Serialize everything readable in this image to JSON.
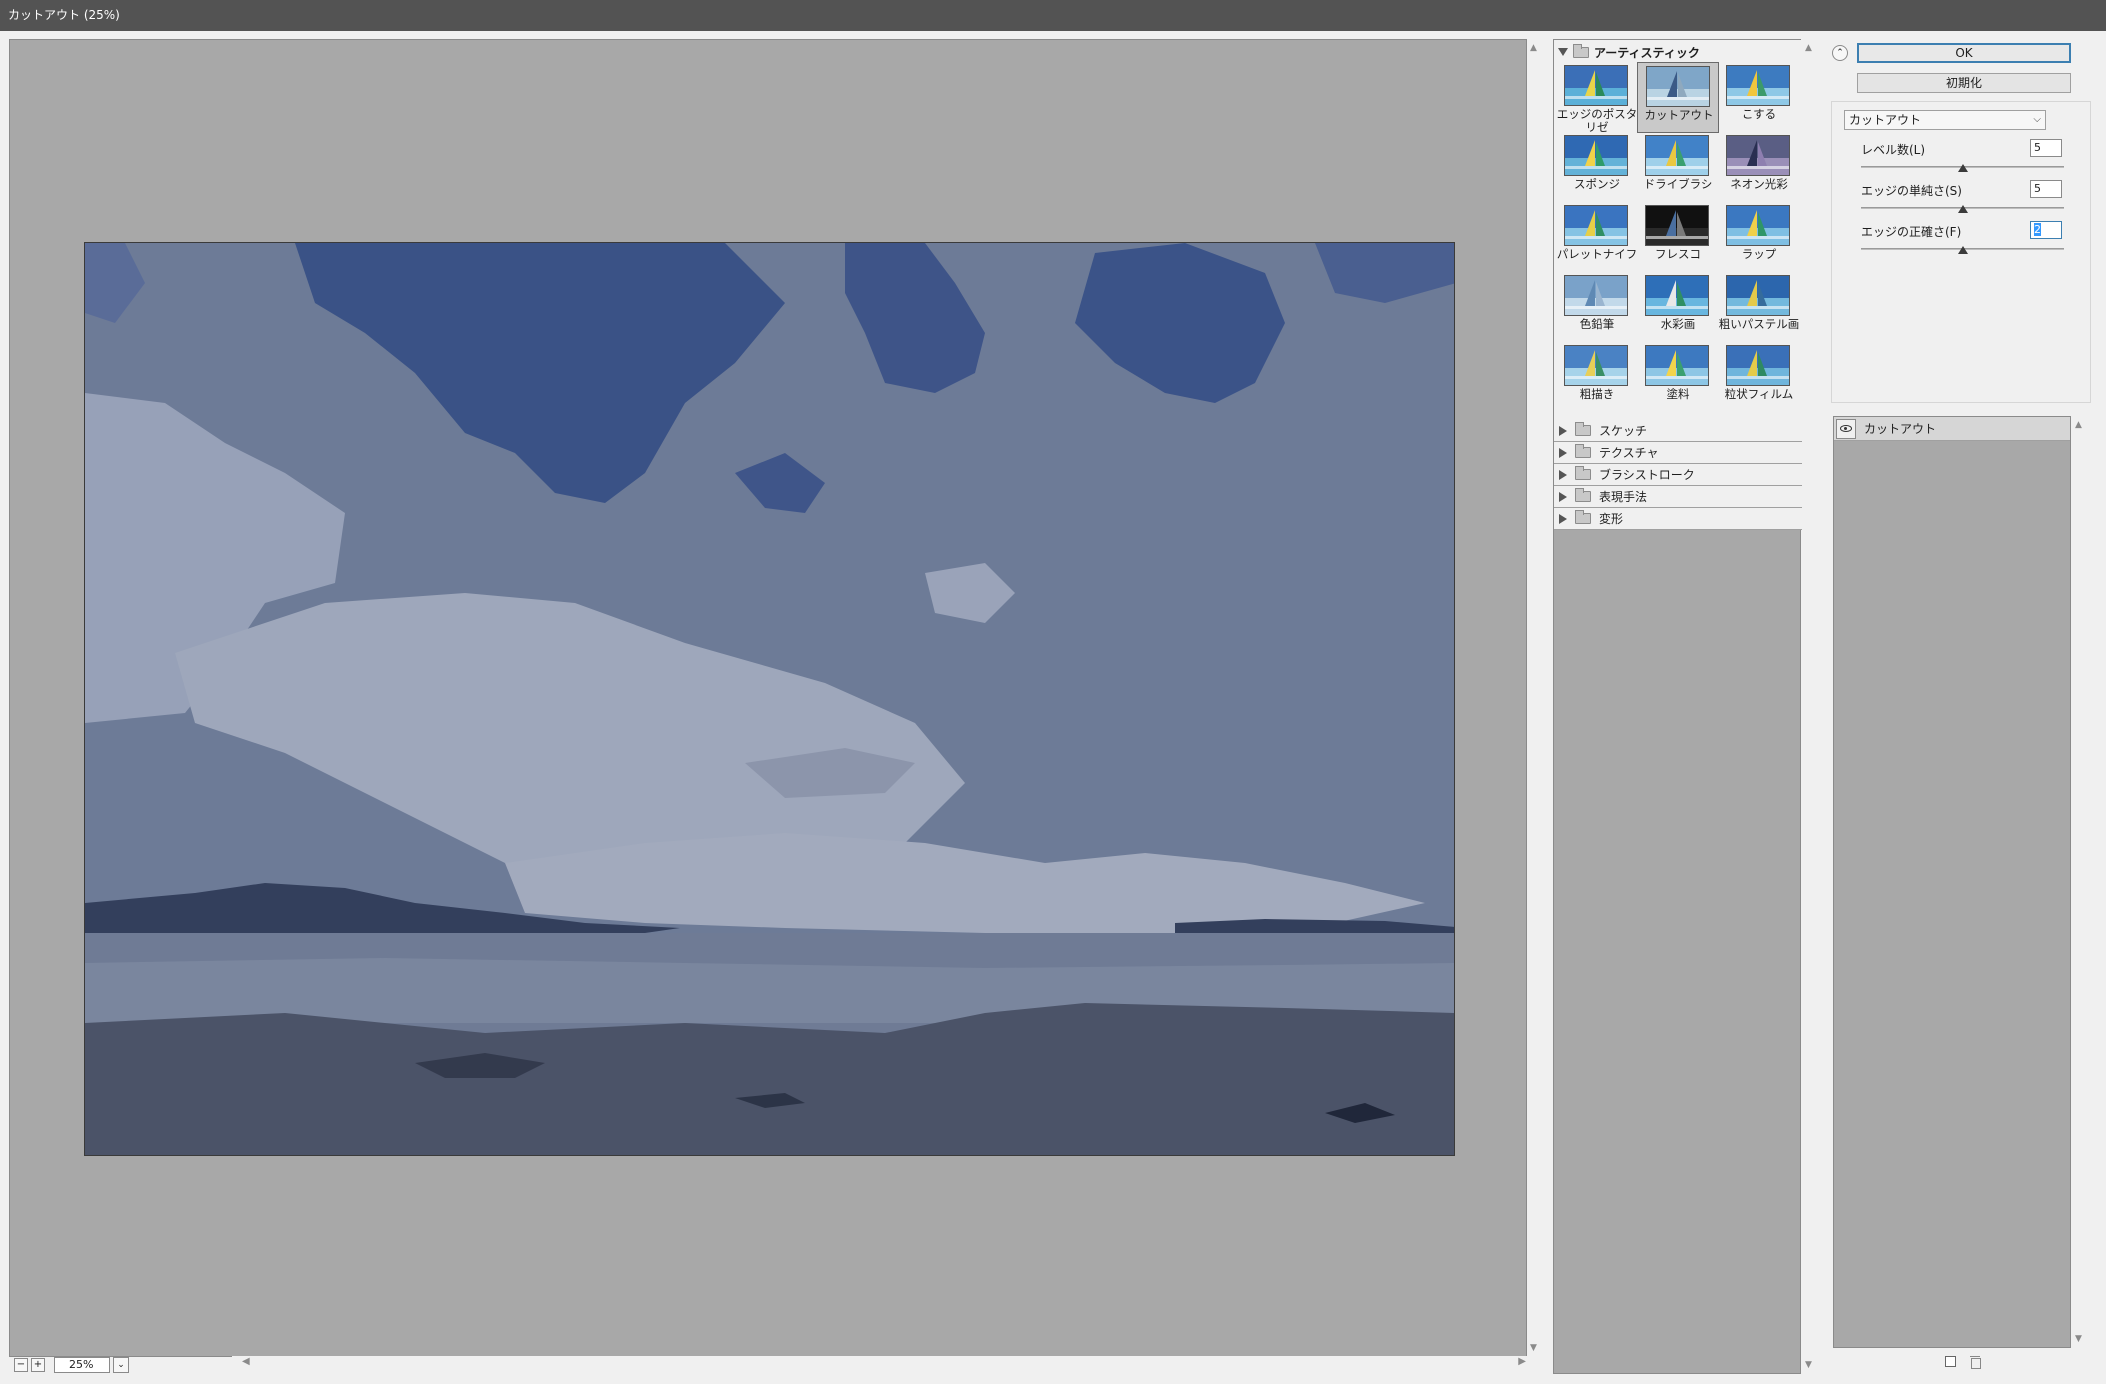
{
  "window": {
    "title": "カットアウト (25%)"
  },
  "zoom": {
    "value": "25%",
    "zoom_out_icon": "minus-icon",
    "zoom_in_icon": "plus-icon"
  },
  "gallery": {
    "open_category": "アーティスティック",
    "thumbnails": [
      {
        "label": "エッジのポスタリゼーション",
        "label_lines": [
          "エッジのポスタリゼ",
          "ーション"
        ],
        "selected": false
      },
      {
        "label": "カットアウト",
        "selected": true
      },
      {
        "label": "こする",
        "selected": false
      },
      {
        "label": "スポンジ",
        "selected": false
      },
      {
        "label": "ドライブラシ",
        "selected": false
      },
      {
        "label": "ネオン光彩",
        "selected": false
      },
      {
        "label": "パレットナイフ",
        "selected": false
      },
      {
        "label": "フレスコ",
        "selected": false
      },
      {
        "label": "ラップ",
        "selected": false
      },
      {
        "label": "色鉛筆",
        "selected": false
      },
      {
        "label": "水彩画",
        "selected": false
      },
      {
        "label": "粗いパステル画",
        "selected": false
      },
      {
        "label": "粗描き",
        "selected": false
      },
      {
        "label": "塗料",
        "selected": false
      },
      {
        "label": "粒状フィルム",
        "selected": false
      }
    ],
    "collapsed_categories": [
      "スケッチ",
      "テクスチャ",
      "ブラシストローク",
      "表現手法",
      "変形"
    ]
  },
  "settings": {
    "ok_label": "OK",
    "reset_label": "初期化",
    "filter_select": "カットアウト",
    "params": [
      {
        "label": "レベル数(L)",
        "value": "5",
        "level": 0.5
      },
      {
        "label": "エッジの単純さ(S)",
        "value": "5",
        "level": 0.5
      },
      {
        "label": "エッジの正確さ(F)",
        "value": "2",
        "level": 0.5
      }
    ]
  },
  "layers": {
    "items": [
      {
        "name": "カットアウト",
        "visible": true
      }
    ]
  },
  "colors": {
    "accent": "#3c7fb1",
    "titlebar": "#535353",
    "preview_bg": "#a8a8a8"
  }
}
